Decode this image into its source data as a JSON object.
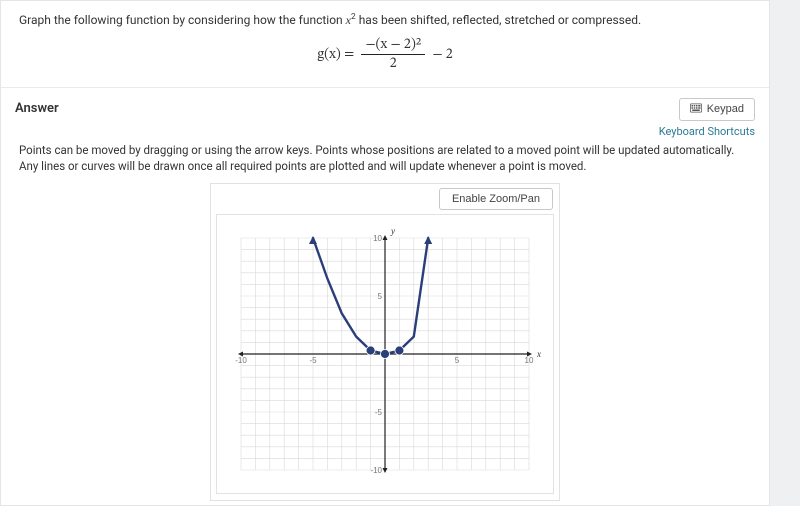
{
  "question": {
    "prompt_pre": "Graph the following function by considering how the function ",
    "prompt_fn": "x",
    "prompt_exp": "2",
    "prompt_post": "  has been shifted, reflected, stretched or compressed.",
    "formula": {
      "lhs": "g(x) = ",
      "numerator": "−(x − 2)²",
      "denominator": "2",
      "tail": " − 2"
    }
  },
  "answer": {
    "label": "Answer",
    "keypad_label": "Keypad",
    "shortcuts_label": "Keyboard Shortcuts",
    "hint": "Points can be moved by dragging or using the arrow keys. Points whose positions are related to a moved point will be updated automatically. Any lines or curves will be drawn once all required points are plotted and will update whenever a point is moved.",
    "zoom_label": "Enable Zoom/Pan"
  },
  "chart_data": {
    "type": "line",
    "xlabel": "x",
    "ylabel": "y",
    "xlim": [
      -10,
      10
    ],
    "ylim": [
      -10,
      10
    ],
    "xticks": [
      -10,
      -5,
      5,
      10
    ],
    "yticks": [
      -10,
      -5,
      5,
      10
    ],
    "series": [
      {
        "name": "parabola",
        "x": [
          -5,
          -4,
          -3,
          -2,
          -1,
          0,
          1,
          2,
          3
        ],
        "values": [
          10,
          6.5,
          3.5,
          1.5,
          0.3,
          0,
          0.3,
          1.5,
          10
        ]
      }
    ],
    "draggable_points": [
      {
        "x": -1,
        "y": 0.3
      },
      {
        "x": 0,
        "y": 0
      },
      {
        "x": 1,
        "y": 0.3
      }
    ]
  }
}
